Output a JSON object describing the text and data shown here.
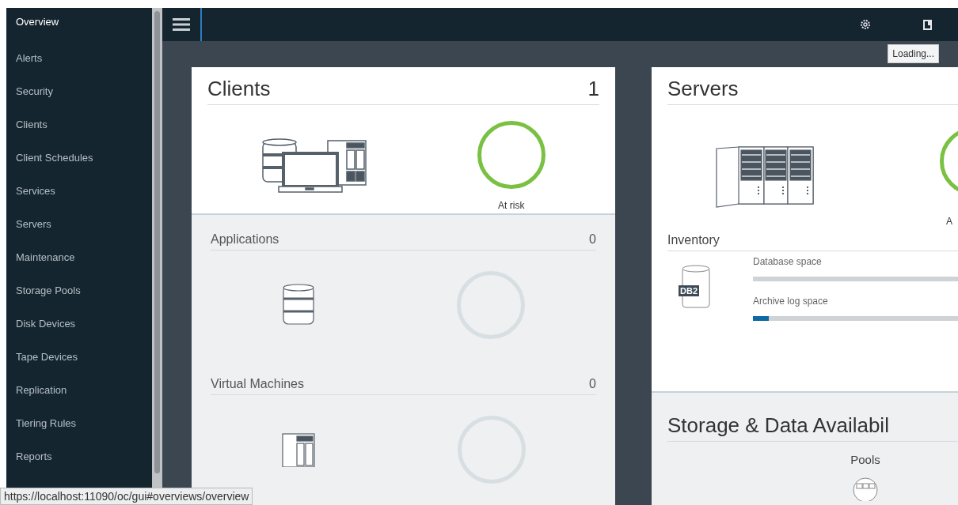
{
  "sidebar": {
    "items": [
      {
        "label": "Overview",
        "selected": true
      },
      {
        "label": "Alerts",
        "selected": false
      },
      {
        "label": "Security",
        "selected": false
      },
      {
        "label": "Clients",
        "selected": false
      },
      {
        "label": "Client Schedules",
        "selected": false
      },
      {
        "label": "Services",
        "selected": false
      },
      {
        "label": "Servers",
        "selected": false
      },
      {
        "label": "Maintenance",
        "selected": false
      },
      {
        "label": "Storage Pools",
        "selected": false
      },
      {
        "label": "Disk Devices",
        "selected": false
      },
      {
        "label": "Tape Devices",
        "selected": false
      },
      {
        "label": "Replication",
        "selected": false
      },
      {
        "label": "Tiering Rules",
        "selected": false
      },
      {
        "label": "Reports",
        "selected": false
      }
    ]
  },
  "header": {
    "tooltip": "Loading..."
  },
  "clients_card": {
    "title": "Clients",
    "count": "1",
    "status_label": "At risk",
    "sections": [
      {
        "kind": "applications",
        "title": "Applications",
        "count": "0"
      },
      {
        "kind": "virtual_machines",
        "title": "Virtual Machines",
        "count": "0"
      }
    ]
  },
  "servers_card": {
    "title": "Servers",
    "status_label": "A",
    "inventory": {
      "title": "Inventory",
      "badge": "DB2",
      "meters": [
        {
          "label": "Database space"
        },
        {
          "label": "Archive log space",
          "level": 0.07
        }
      ]
    }
  },
  "storage_card": {
    "title": "Storage & Data Availabil",
    "pools_label": "Pools"
  },
  "status_bar": {
    "url": "https://localhost:11090/oc/gui#overviews/overview"
  }
}
